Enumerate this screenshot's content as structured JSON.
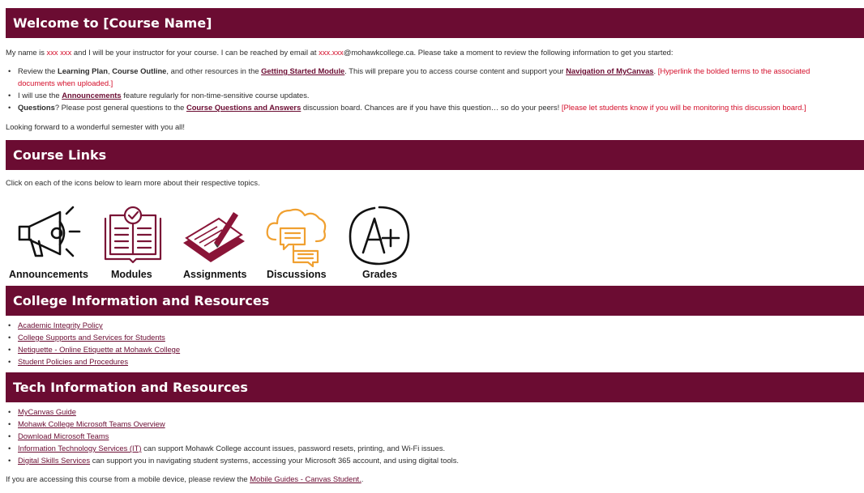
{
  "welcome": {
    "heading": "Welcome to [Course Name]",
    "intro_1": "My name is ",
    "instructor_name": "xxx xxx",
    "intro_2": " and I will be your instructor for your course. I can be reached by email at ",
    "email_user": "xxx.xxx",
    "email_domain": "@mohawkcollege.ca",
    "intro_3": ". Please take a moment to review the following information to get you started:",
    "bullets": {
      "b1_pre": "Review the ",
      "b1_lp": "Learning Plan",
      "b1_comma": ", ",
      "b1_co": "Course Outline",
      "b1_mid": ", and other resources in the ",
      "b1_gsm_link": "Getting Started Module",
      "b1_post": ". This will prepare you to access course content and support your ",
      "b1_nav_link": "Navigation of MyCanvas",
      "b1_end": ".",
      "b1_note_1": " [Hyperlink the bolded terms to the associated",
      "b1_note_2": "documents when uploaded.]",
      "b2_pre": "I will use the ",
      "b2_link": "Announcements",
      "b2_post": " feature regularly for non-time-sensitive course updates.",
      "b3_q": "Questions",
      "b3_pre": "? Please post general questions to the ",
      "b3_link": "Course Questions and Answers",
      "b3_post": " discussion board. Chances are if you have this question… so do your peers! ",
      "b3_note": "[Please let students know if you will be monitoring this discussion board.]"
    },
    "closing": "Looking forward to a wonderful semester with you all!"
  },
  "course_links": {
    "heading": "Course Links",
    "instruction": "Click on each of the icons below to learn more about their respective topics.",
    "icons": [
      {
        "label": "Announcements",
        "icon": "megaphone-icon"
      },
      {
        "label": "Modules",
        "icon": "book-checklist-icon"
      },
      {
        "label": "Assignments",
        "icon": "paper-pencil-icon"
      },
      {
        "label": "Discussions",
        "icon": "cloud-chat-icon"
      },
      {
        "label": "Grades",
        "icon": "a-plus-grade-icon"
      }
    ]
  },
  "college_resources": {
    "heading": "College Information and Resources",
    "links": [
      "Academic Integrity Policy",
      "College Supports and Services for Students",
      "Netiquette - Online Etiquette at Mohawk College",
      "Student Policies and Procedures"
    ]
  },
  "tech_resources": {
    "heading": "Tech Information and Resources",
    "links": [
      "MyCanvas Guide",
      "Mohawk College Microsoft Teams Overview",
      "Download Microsoft Teams"
    ],
    "its_link": "Information Technology Services (IT)",
    "its_text": " can support Mohawk College account issues, password resets, printing, and Wi-Fi issues.",
    "dss_link": "Digital Skills Services",
    "dss_text": " can support you in navigating student systems, accessing your Microsoft 365 account, and using digital tools.",
    "mobile_pre": "If you are accessing this course from a mobile device, please review the ",
    "mobile_link": "Mobile Guides - Canvas Student.",
    "mobile_post": "."
  },
  "colors": {
    "banner": "#6b0c32",
    "accent_red": "#d40e2a",
    "discussion_orange": "#f0a030"
  }
}
